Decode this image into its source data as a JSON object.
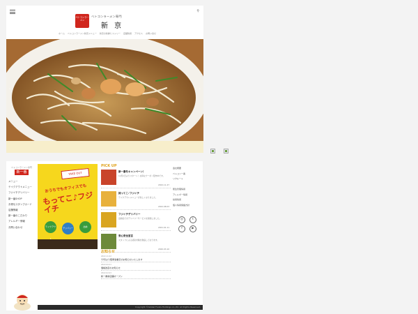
{
  "header": {
    "logo_badge": "ベトコンラーメン",
    "logo_small": "ベトコンラーメン専門",
    "logo_big": "新 京",
    "nav": [
      "ホーム",
      "ベトコンラーメン新京メニュー",
      "新京の新鮮ヒストリー",
      "店舗情報",
      "アクセス",
      "お問い合せ"
    ]
  },
  "sidebar": {
    "logo_caption": "ベトコンラーメン専門",
    "logo_name": "新一番",
    "items": [
      "メニュー",
      "テイクアウトメニュー",
      "フジイチデリバリー",
      "新一番SHOP",
      "お得なスタンプカード",
      "店舗情報",
      "新一番のこだわり",
      "アレルギー情報",
      "お問い合わせ"
    ]
  },
  "poster": {
    "tag": "TAKE OUT",
    "sub": "おうちでもオフィスでも",
    "main": "もってこ♪フジイチ",
    "circles": [
      "テイクアウト",
      "デリバリー",
      "出前"
    ]
  },
  "pickup": {
    "title": "PICK UP",
    "items": [
      {
        "title": "新一番冬キャンペーン！",
        "body": "12月1日よりスタート！お得なクーポン配布中です。",
        "date": "2022.11.27",
        "color": "#c9442a"
      },
      {
        "title": "持ってこ♪フジイチ",
        "body": "テイクアウトメニューが新しくなりました。",
        "date": "2022.08.03",
        "color": "#e8b13c"
      },
      {
        "title": "フジイチデリバリー",
        "body": "出前館でのデリバリーサービスを開始しました。",
        "date": "2021.01.11",
        "color": "#d9a521"
      },
      {
        "title": "安心安全宣言",
        "body": "スタッフによる感染対策を徹底しております。",
        "date": "2020.03.10",
        "color": "#6d8a3a"
      }
    ]
  },
  "news": {
    "title": "お知らせ",
    "items": [
      {
        "date": "2022.11.02",
        "text": "12月より臨時営業日のお知らせいたします"
      },
      {
        "date": "2022.09.21",
        "text": "価格改定のお知らせ"
      },
      {
        "date": "2022.02.03",
        "text": "新一番新店舗オープン"
      }
    ]
  },
  "right_links": [
    "会社概要",
    "ベトコン一番",
    "リクルート",
    "",
    "衛生管理情報",
    "アレルギー情報",
    "採用情報",
    "個人情報保護方針"
  ],
  "social": [
    "◎",
    "t",
    "f",
    "▶"
  ],
  "footer": "Copyright ©Global Foods Holdings co.,ltd. All Rights Reserved."
}
